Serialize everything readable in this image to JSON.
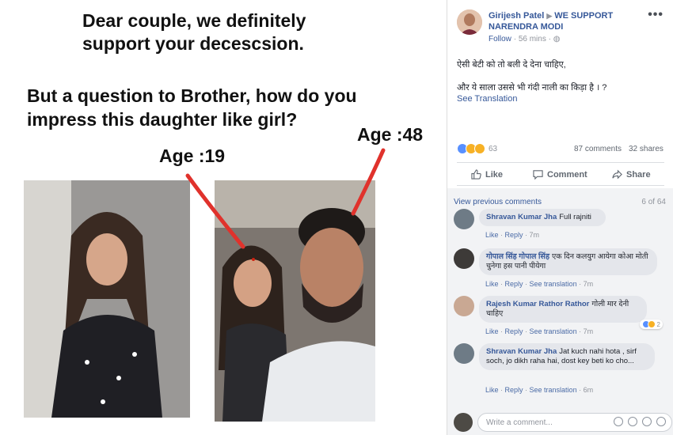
{
  "meme": {
    "line1": "Dear couple, we definitely support your decescsion.",
    "line2": "But a question to Brother, how do you impress this daughter like girl?",
    "age_left": "Age :19",
    "age_right": "Age :48",
    "arrow_color": "#e0322c"
  },
  "post": {
    "author": "Girijesh Patel",
    "group": "WE SUPPORT NARENDRA MODI",
    "follow": "Follow",
    "time": "56 mins",
    "text1": "ऐसी बेटी को तो बली दे देना चाहिए,",
    "text2": "और ये साला उससे भी गंदी नाली का किड़ा है । ?",
    "see_translation": "See Translation",
    "reaction_count": "63",
    "comments": "87 comments",
    "shares": "32 shares",
    "like": "Like",
    "comment": "Comment",
    "share": "Share"
  },
  "comments_section": {
    "view_previous": "View previous comments",
    "count_of": "6 of 64",
    "items": [
      {
        "name": "Shravan Kumar Jha",
        "text": "Full rajniti",
        "like": "Like",
        "reply": "Reply",
        "see_translation": "",
        "time": "7m"
      },
      {
        "name": "गोपाल सिंह गोपाल सिंह",
        "text": "एक दिन कलयुग आयेगा कोआ मोती चुनेगा हस पानी पीयेगा",
        "like": "Like",
        "reply": "Reply",
        "see_translation": "See translation",
        "time": "7m"
      },
      {
        "name": "Rajesh Kumar Rathor Rathor",
        "text": "गोली मार देनी चाहिए",
        "like": "Like",
        "reply": "Reply",
        "see_translation": "See translation",
        "time": "7m",
        "reactions": "2"
      },
      {
        "name": "Shravan Kumar Jha",
        "text": "Jat kuch nahi hota , sirf soch, jo dikh raha hai, dost key beti ko cho...",
        "like": "Like",
        "reply": "Reply",
        "see_translation": "See translation",
        "time": "6m"
      }
    ],
    "write_placeholder": "Write a comment..."
  }
}
